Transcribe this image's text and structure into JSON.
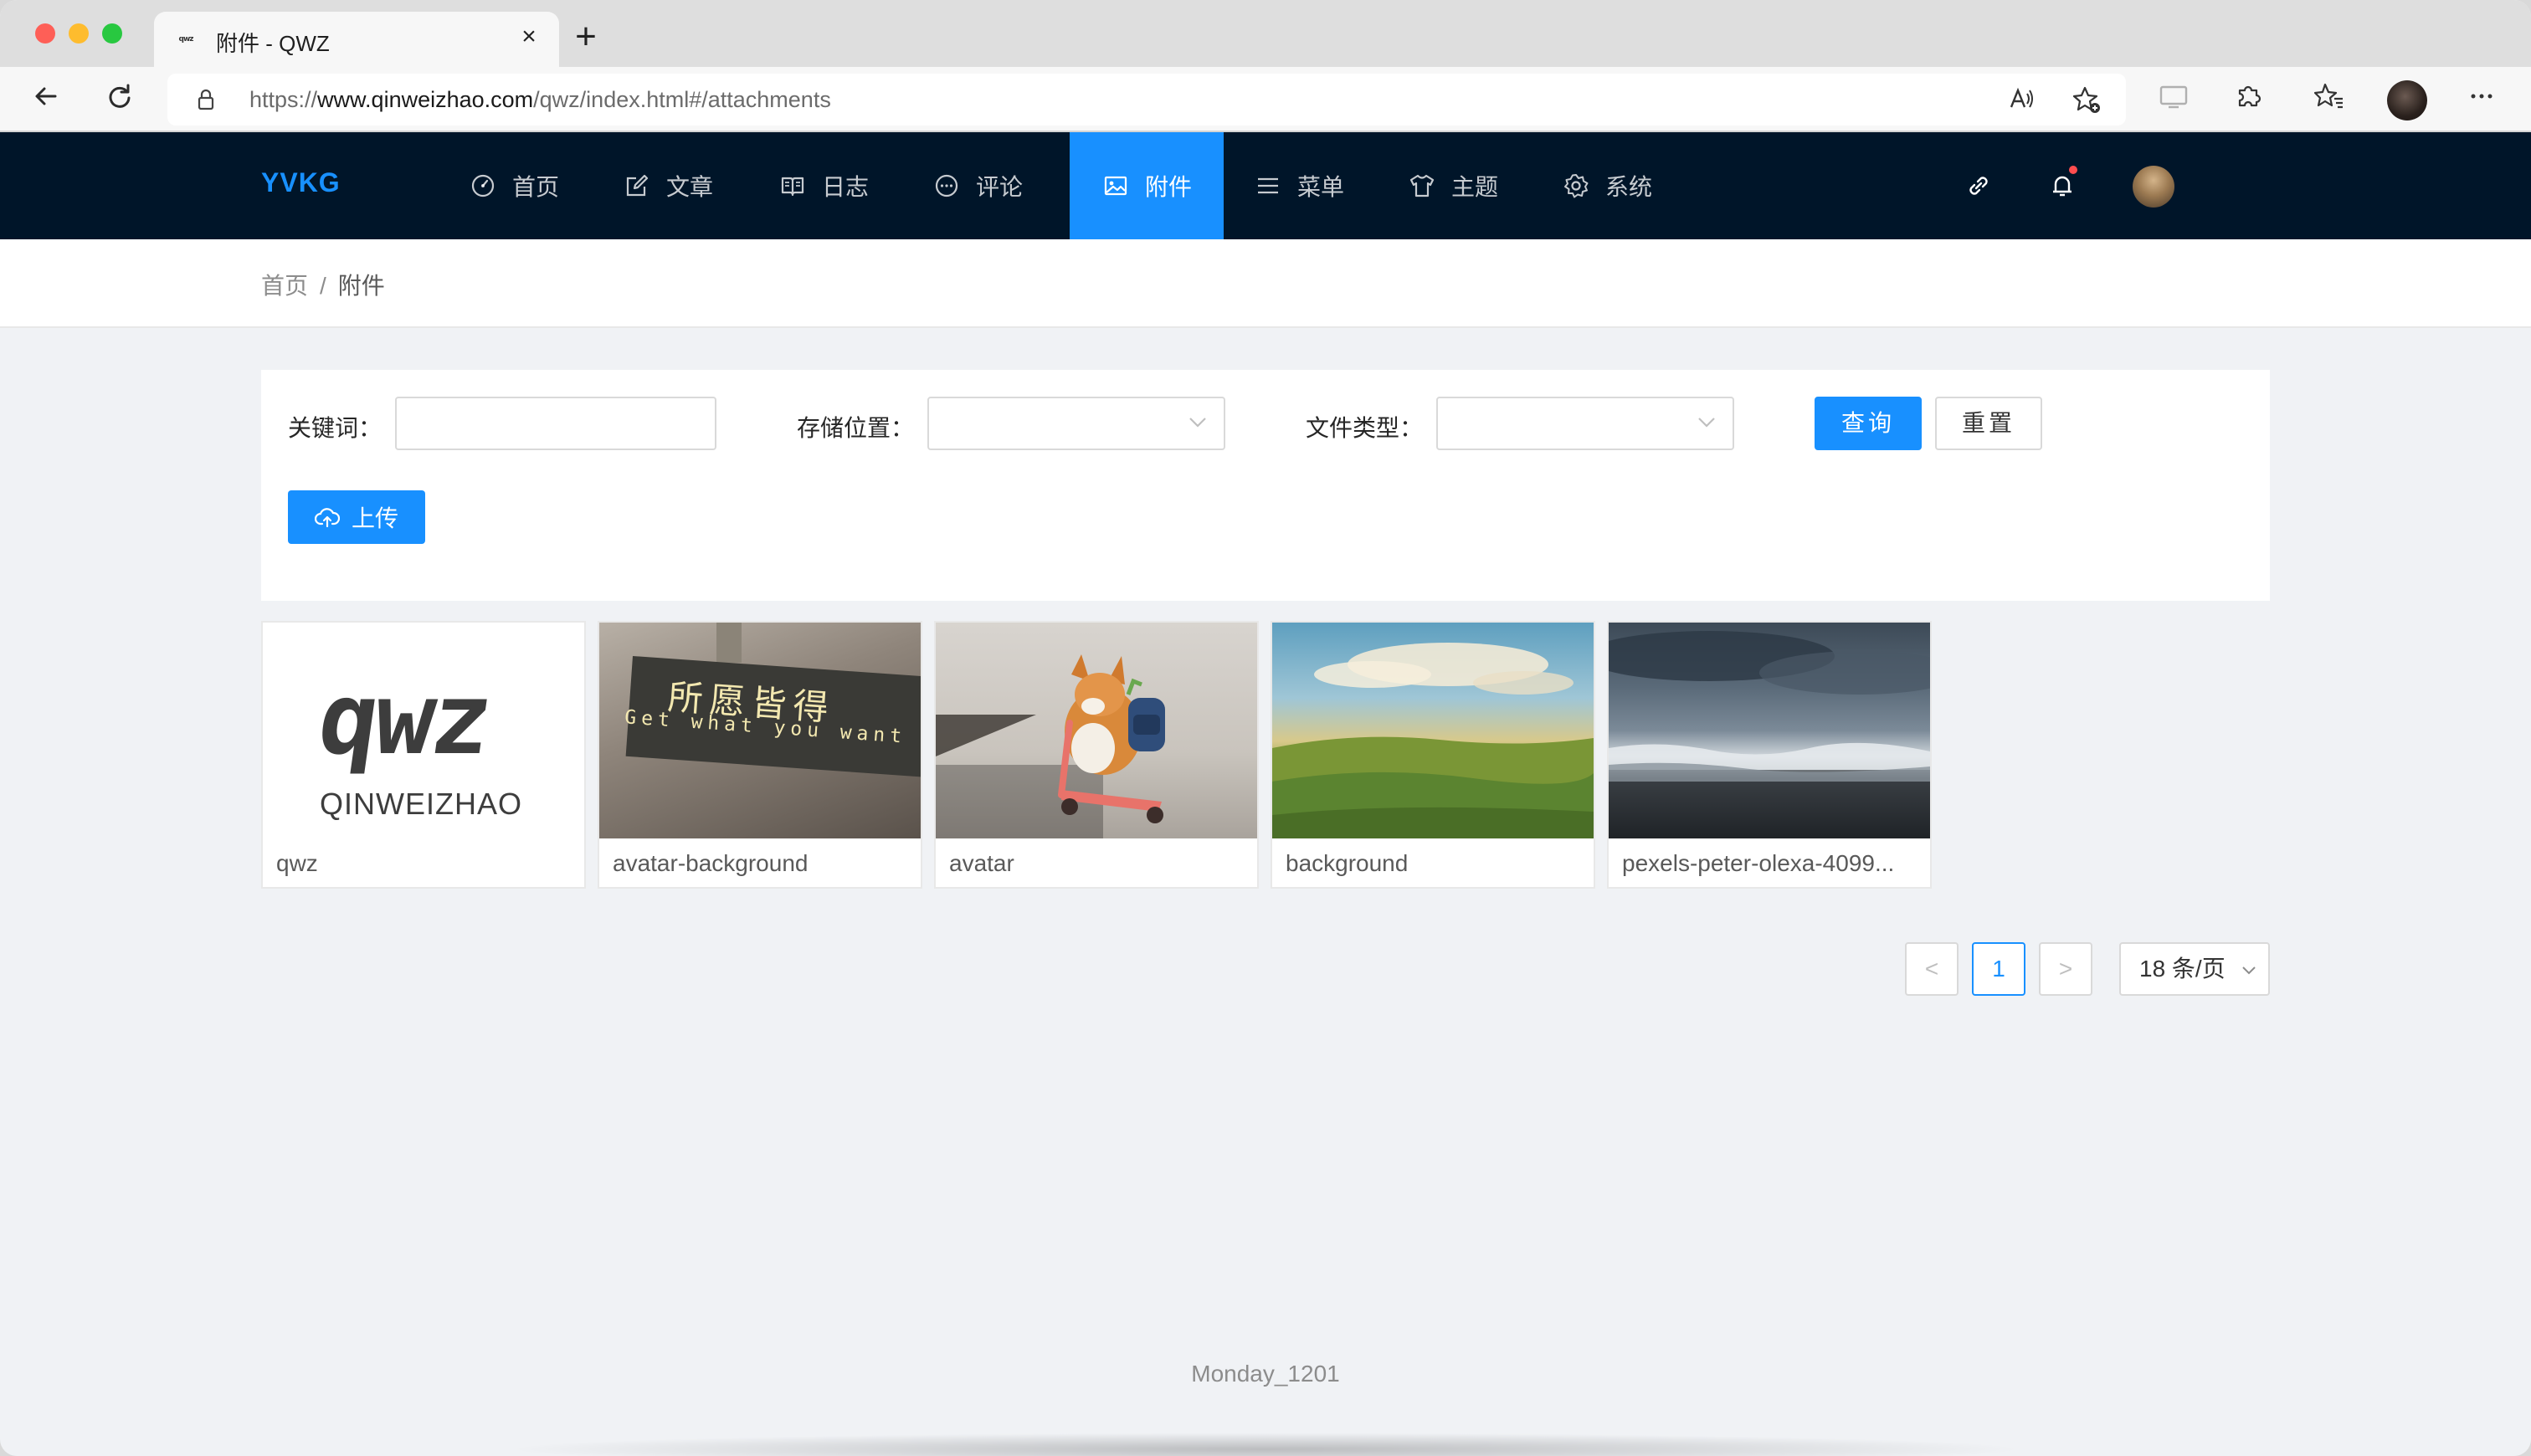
{
  "browser": {
    "tab_title": "附件 - QWZ",
    "favicon_text": "qwz",
    "url_prefix": "https://",
    "url_domain": "www.qinweizhao.com",
    "url_path": "/qwz/index.html#/attachments"
  },
  "header": {
    "logo": "YVKG",
    "nav": [
      {
        "label": "首页",
        "icon": "dashboard-icon"
      },
      {
        "label": "文章",
        "icon": "edit-icon"
      },
      {
        "label": "日志",
        "icon": "book-icon"
      },
      {
        "label": "评论",
        "icon": "comment-icon"
      },
      {
        "label": "附件",
        "icon": "picture-icon",
        "active": true
      },
      {
        "label": "菜单",
        "icon": "menu-icon"
      },
      {
        "label": "主题",
        "icon": "skin-icon"
      },
      {
        "label": "系统",
        "icon": "setting-icon"
      }
    ],
    "accent_color": "#1890ff",
    "background_color": "#001529"
  },
  "breadcrumb": {
    "home": "首页",
    "separator": "/",
    "current": "附件"
  },
  "filters": {
    "keyword_label": "关键词：",
    "keyword_value": "",
    "storage_label": "存储位置：",
    "storage_value": "",
    "filetype_label": "文件类型：",
    "filetype_value": "",
    "search_button": "查询",
    "reset_button": "重置",
    "upload_button": "上传"
  },
  "attachments": [
    {
      "name": "qwz"
    },
    {
      "name": "avatar-background",
      "image_text_cn": "所愿皆得",
      "image_text_en": "Get what you want"
    },
    {
      "name": "avatar"
    },
    {
      "name": "background"
    },
    {
      "name": "pexels-peter-olexa-4099..."
    }
  ],
  "thumb_qwz": {
    "big": "qwz",
    "small": "QINWEIZHAO"
  },
  "pagination": {
    "prev": "<",
    "current_page": "1",
    "next": ">",
    "page_size": "18 条/页"
  },
  "footer": {
    "text": "Monday_1201"
  }
}
